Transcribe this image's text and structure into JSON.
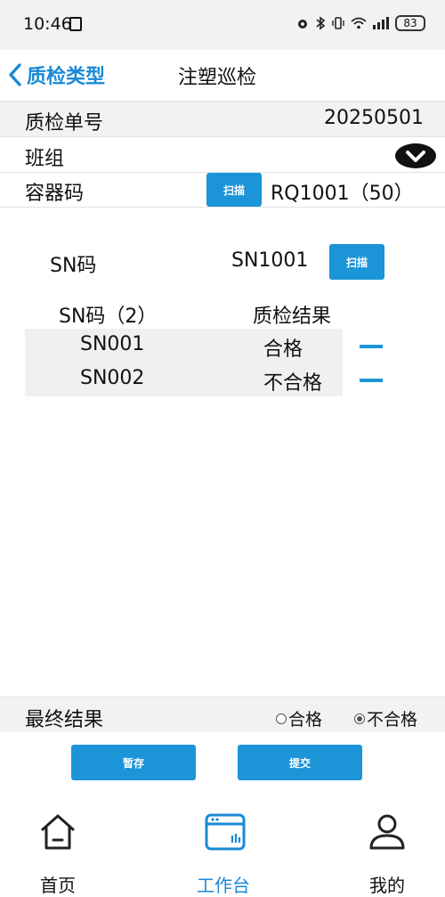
{
  "status_bar": {
    "time": "10:46",
    "battery": "83"
  },
  "header": {
    "back_label": "质检类型",
    "title": "注塑巡检"
  },
  "form": {
    "order_label": "质检单号",
    "order_value": "20250501",
    "team_label": "班组",
    "container_label": "容器码",
    "container_scan_label": "扫描",
    "container_value": "RQ1001（50）"
  },
  "sn": {
    "label": "SN码",
    "value": "SN1001",
    "scan_label": "扫描",
    "table_header_code": "SN码（2）",
    "table_header_result": "质检结果",
    "rows": [
      {
        "code": "SN001",
        "result": "合格"
      },
      {
        "code": "SN002",
        "result": "不合格"
      }
    ]
  },
  "final": {
    "label": "最终结果",
    "options": [
      {
        "label": "合格",
        "selected": false
      },
      {
        "label": "不合格",
        "selected": true
      }
    ]
  },
  "actions": {
    "save_label": "暂存",
    "submit_label": "提交"
  },
  "tabbar": {
    "items": [
      {
        "label": "首页",
        "icon": "home-icon",
        "active": false
      },
      {
        "label": "工作台",
        "icon": "workbench-icon",
        "active": true
      },
      {
        "label": "我的",
        "icon": "user-icon",
        "active": false
      }
    ]
  },
  "colors": {
    "accent": "#1b94d8",
    "row_bg": "#f2f2f2"
  }
}
